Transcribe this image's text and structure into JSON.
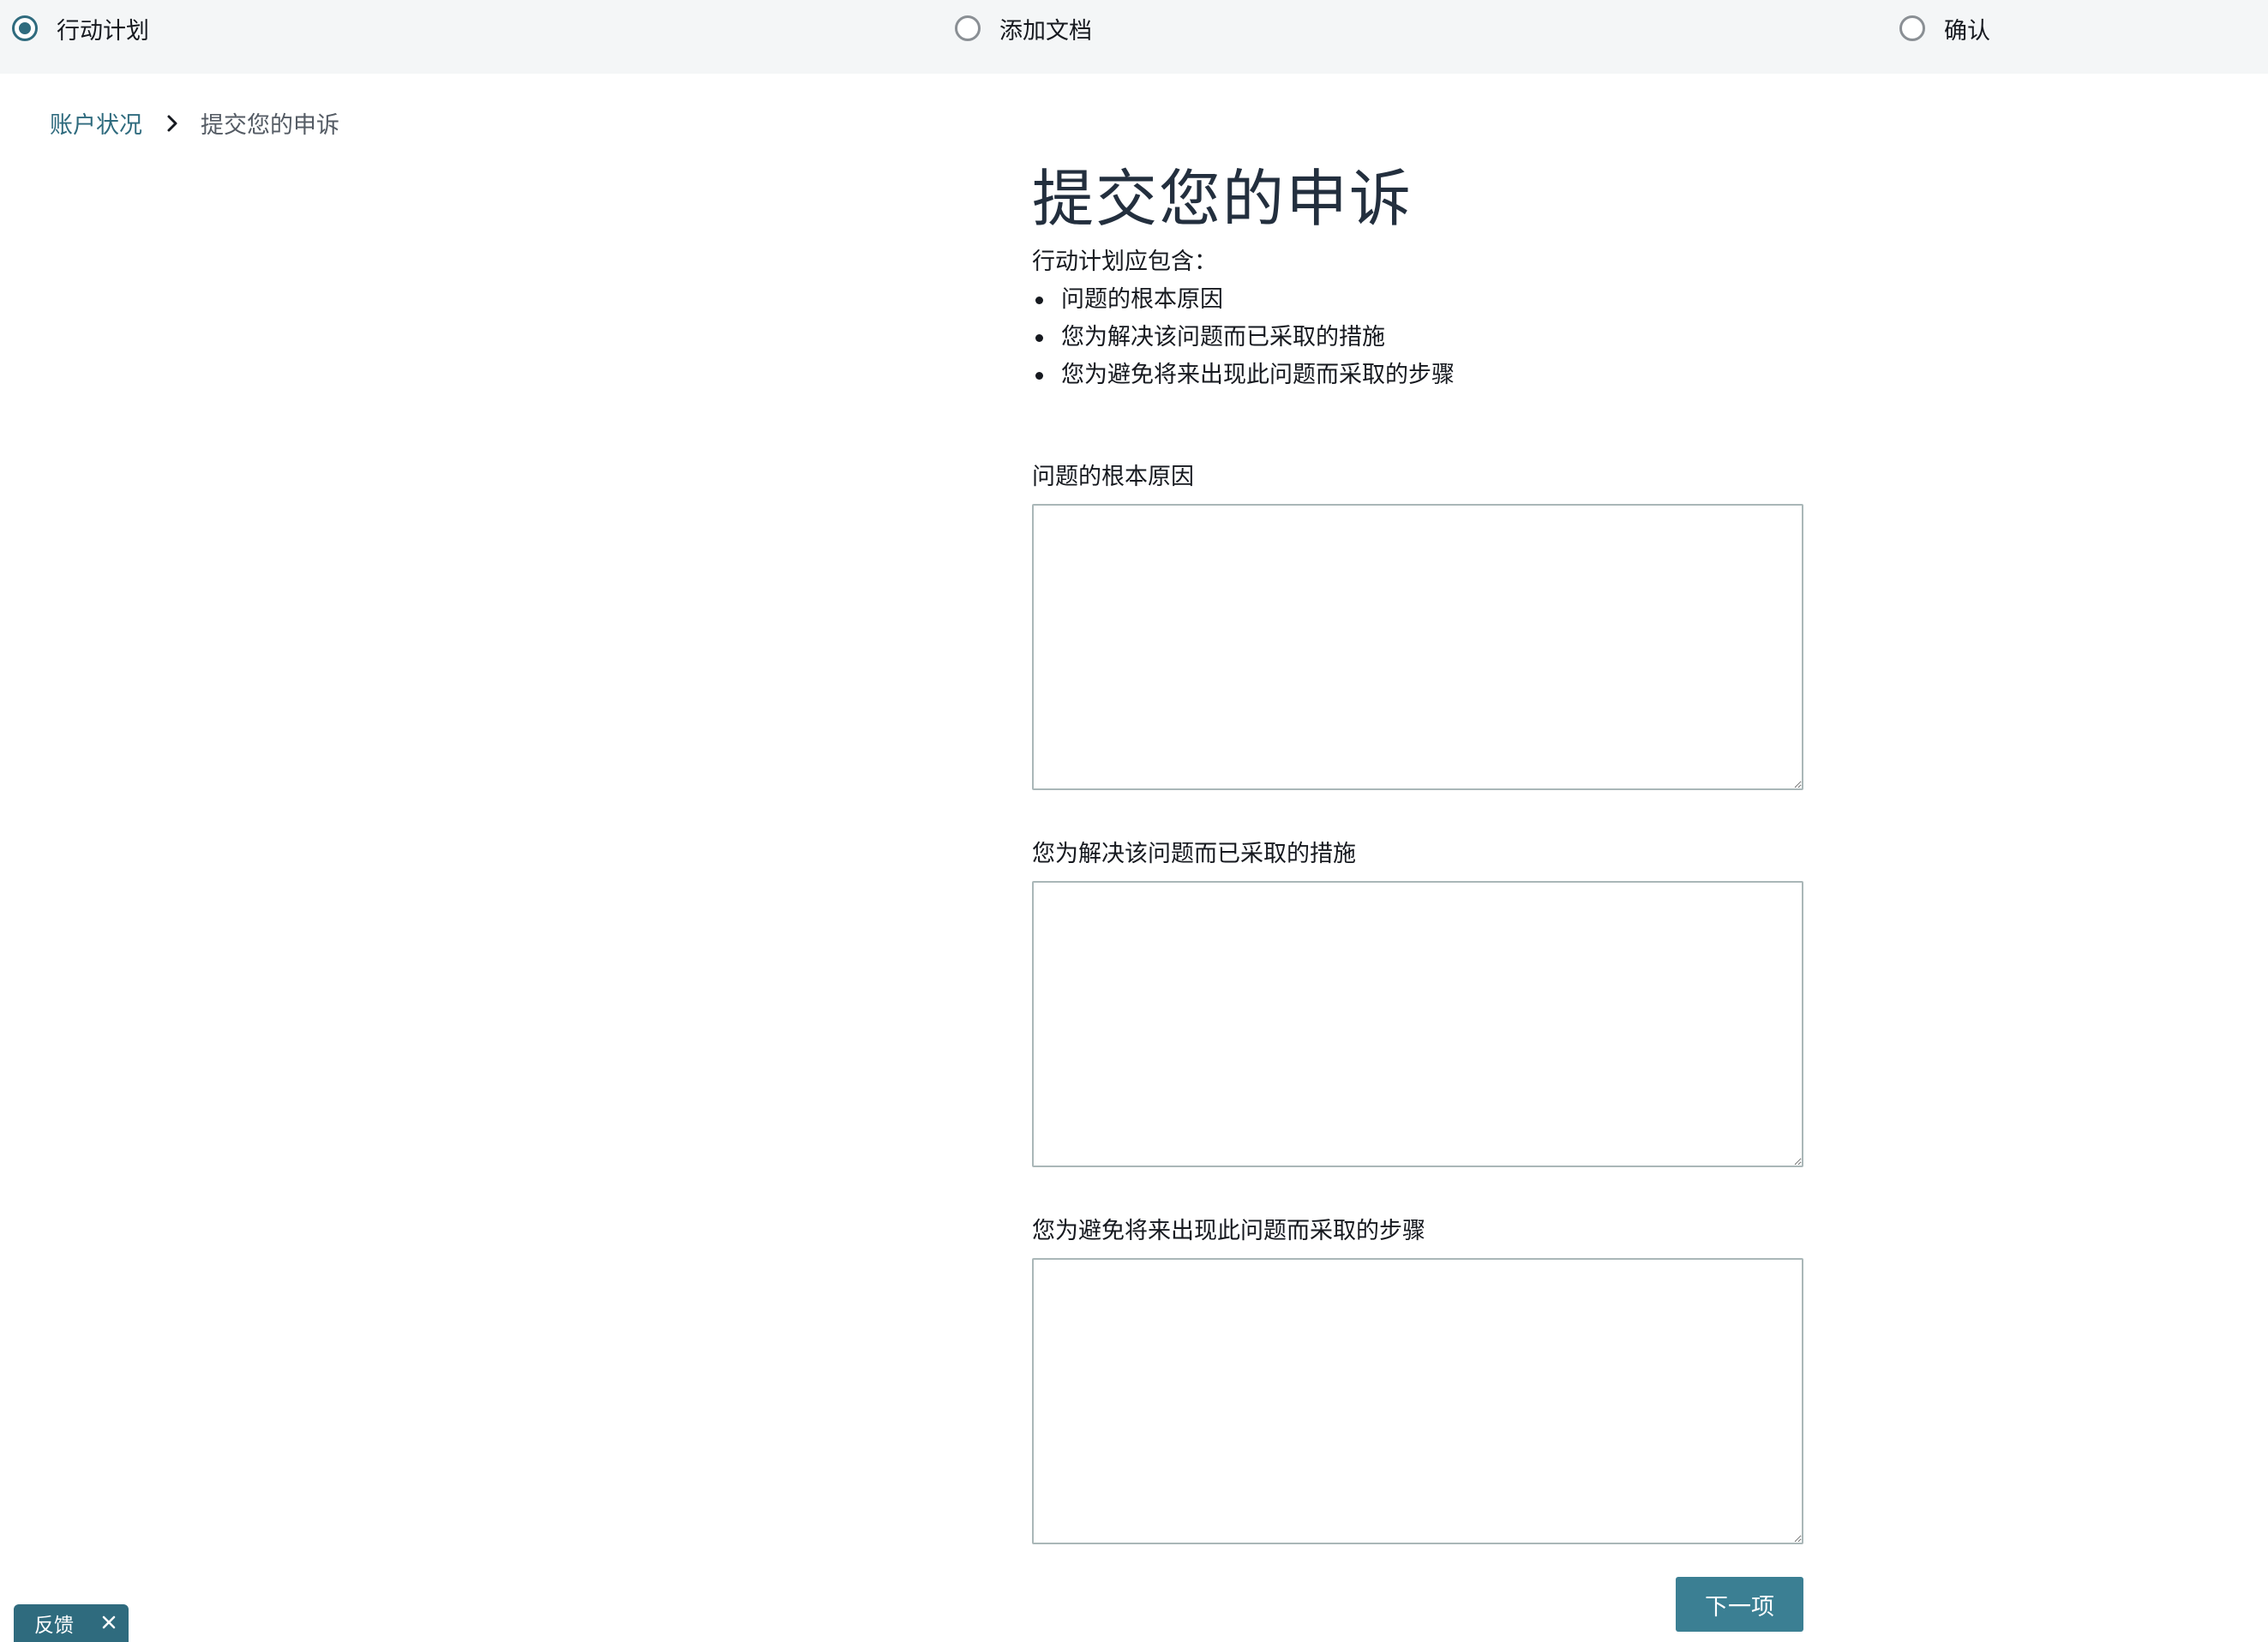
{
  "stepper": {
    "steps": [
      {
        "label": "行动计划",
        "state": "current"
      },
      {
        "label": "添加文档",
        "state": "upcoming"
      },
      {
        "label": "确认",
        "state": "upcoming"
      }
    ]
  },
  "breadcrumb": {
    "parent_label": "账户状况",
    "current_label": "提交您的申诉"
  },
  "main": {
    "title": "提交您的申诉",
    "intro": "行动计划应包含：",
    "bullets": [
      "问题的根本原因",
      "您为解决该问题而已采取的措施",
      "您为避免将来出现此问题而采取的步骤"
    ],
    "fields": [
      {
        "label": "问题的根本原因",
        "value": ""
      },
      {
        "label": "您为解决该问题而已采取的措施",
        "value": ""
      },
      {
        "label": "您为避免将来出现此问题而采取的步骤",
        "value": ""
      }
    ],
    "next_button_label": "下一项"
  },
  "feedback": {
    "label": "反馈"
  },
  "colors": {
    "accent": "#2f6b7e",
    "button": "#3b7f93",
    "stepper_bg": "#f4f6f7",
    "border": "#aab7b8"
  }
}
